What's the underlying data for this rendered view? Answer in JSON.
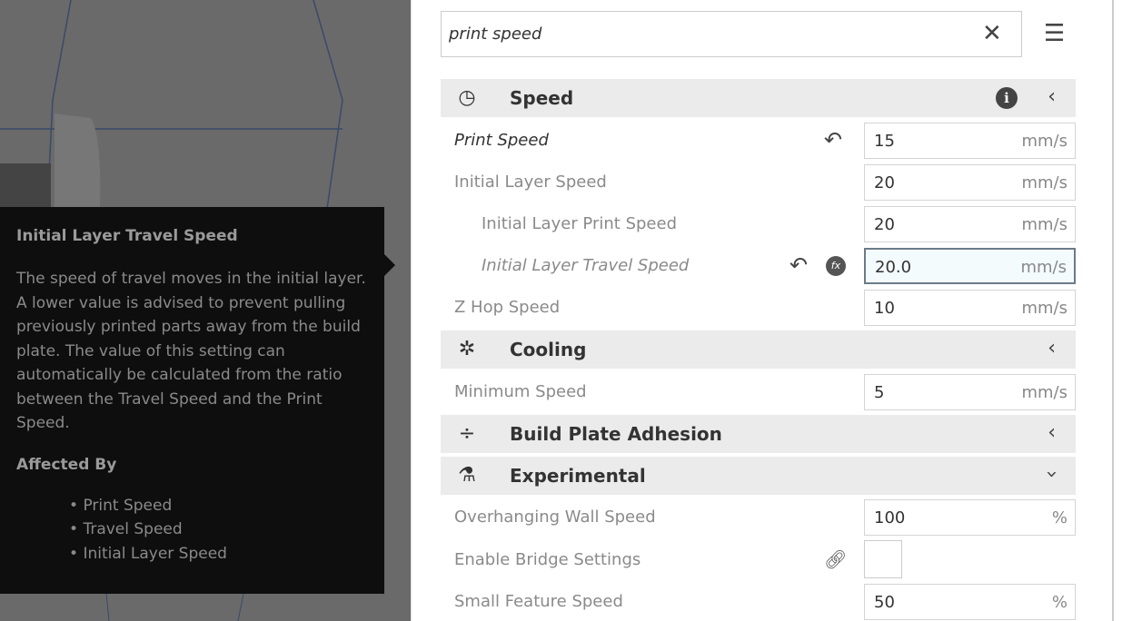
{
  "tooltip": {
    "title": "Initial Layer Travel Speed",
    "body": "The speed of travel moves in the initial layer. A lower value is advised to prevent pulling previously printed parts away from the build plate. The value of this setting can automatically be calculated from the ratio between the Travel Speed and the Print Speed.",
    "affected_label": "Affected By",
    "affected": [
      "Print Speed",
      "Travel Speed",
      "Initial Layer Speed"
    ]
  },
  "search": {
    "value": "print speed"
  },
  "sections": {
    "speed": {
      "label": "Speed",
      "icon": "speedometer-icon"
    },
    "cooling": {
      "label": "Cooling",
      "icon": "fan-icon"
    },
    "adhesion": {
      "label": "Build Plate Adhesion",
      "icon": "adhesion-icon"
    },
    "experimental": {
      "label": "Experimental",
      "icon": "flask-icon"
    }
  },
  "settings": [
    {
      "label": "Print Speed",
      "value": "15",
      "unit": "mm/s"
    },
    {
      "label": "Initial Layer Speed",
      "value": "20",
      "unit": "mm/s"
    },
    {
      "label": "Initial Layer Print Speed",
      "value": "20",
      "unit": "mm/s"
    },
    {
      "label": "Initial Layer Travel Speed",
      "value": "20.0",
      "unit": "mm/s"
    },
    {
      "label": "Z Hop Speed",
      "value": "10",
      "unit": "mm/s"
    },
    {
      "label": "Minimum Speed",
      "value": "5",
      "unit": "mm/s"
    },
    {
      "label": "Overhanging Wall Speed",
      "value": "100",
      "unit": "%"
    },
    {
      "label": "Enable Bridge Settings",
      "checked": false
    },
    {
      "label": "Small Feature Speed",
      "value": "50",
      "unit": "%"
    }
  ],
  "colors": {
    "viewport": "#6a6a6a",
    "tooltip": "#0e0e0e",
    "header": "#ebebeb"
  }
}
